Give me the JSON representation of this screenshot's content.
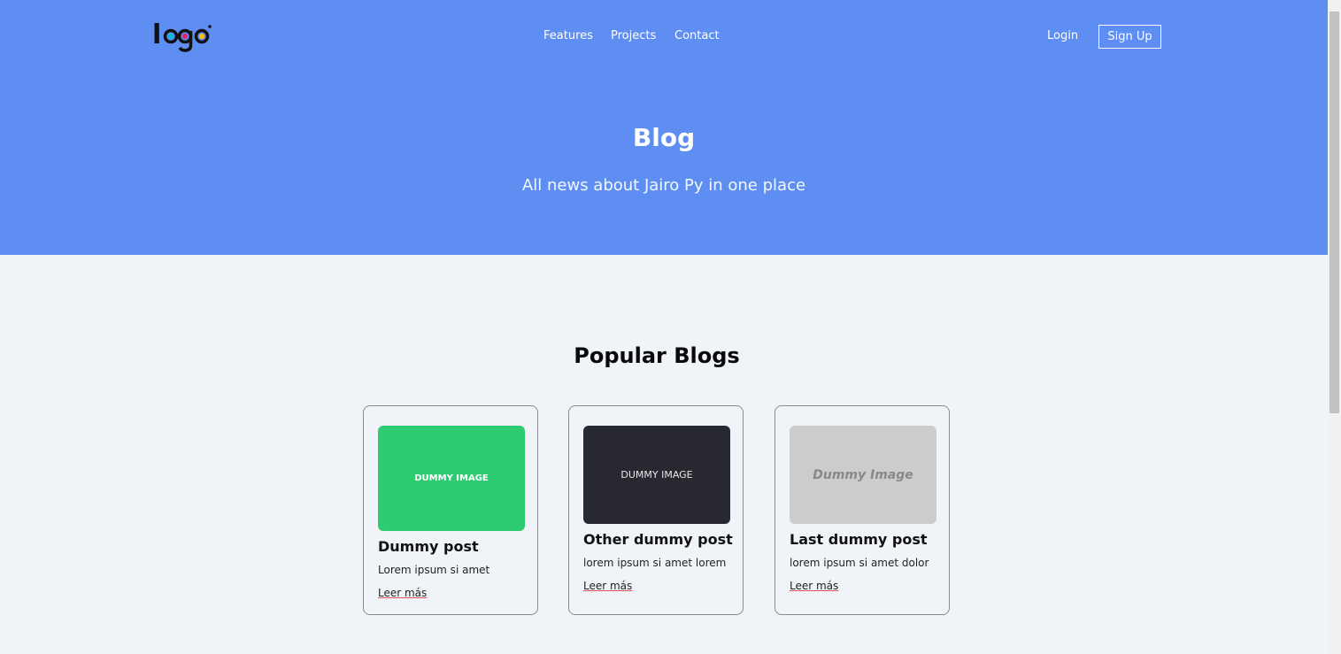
{
  "header": {
    "logo_text": "logo",
    "nav": [
      {
        "label": "Features"
      },
      {
        "label": "Projects"
      },
      {
        "label": "Contact"
      }
    ],
    "login_label": "Login",
    "signup_label": "Sign Up"
  },
  "hero": {
    "title": "Blog",
    "subtitle": "All news about Jairo Py in one place"
  },
  "popular": {
    "title": "Popular Blogs",
    "cards": [
      {
        "image_text": "DUMMY IMAGE",
        "title": "Dummy post",
        "text": "Lorem ipsum si amet",
        "link": "Leer más",
        "image_color": "#2ecc71"
      },
      {
        "image_text": "DUMMY IMAGE",
        "title": "Other dummy post",
        "text": "lorem ipsum si amet lorem",
        "link": "Leer más",
        "image_color": "#282830"
      },
      {
        "image_text": "Dummy Image",
        "title": "Last dummy post",
        "text": "lorem ipsum si amet dolor",
        "link": "Leer más",
        "image_color": "#cccccc"
      }
    ]
  },
  "colors": {
    "hero_bg": "#5f8ef3",
    "page_bg": "#f0f4f8",
    "logo_dots": [
      "#00bcd4",
      "#e91e63",
      "#ffc107"
    ]
  }
}
